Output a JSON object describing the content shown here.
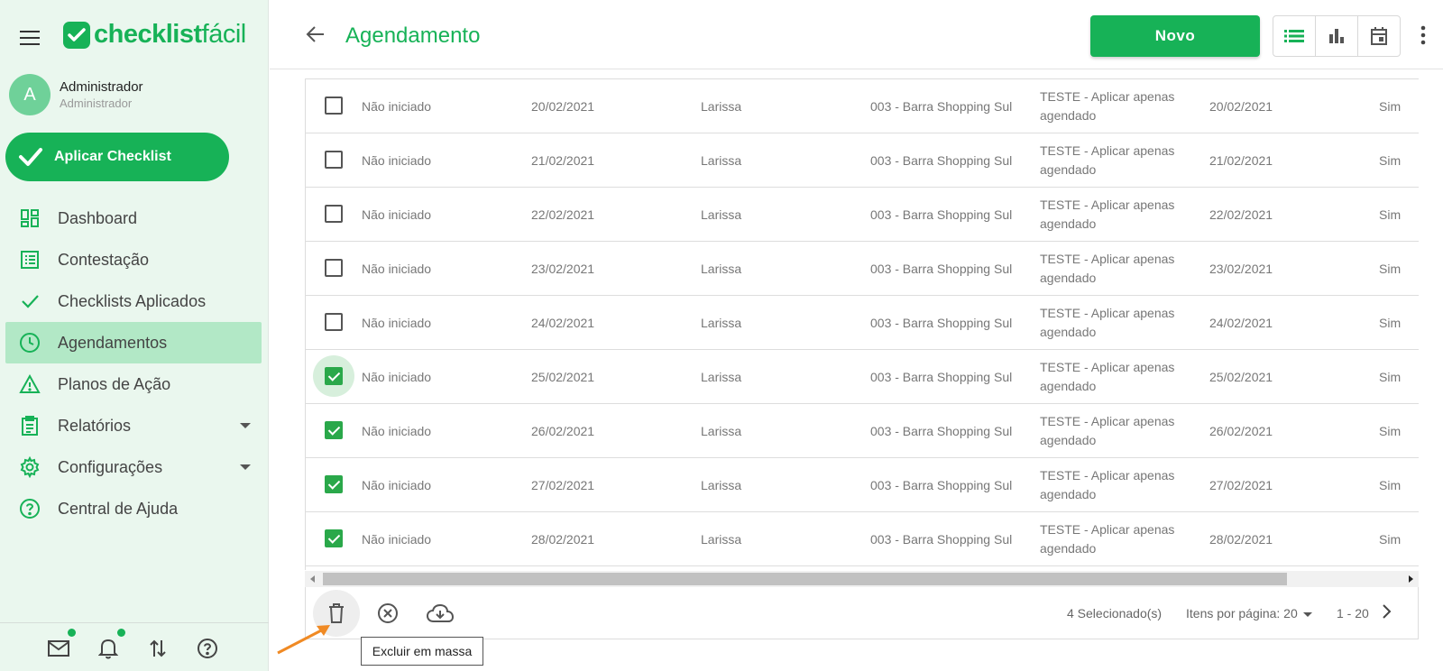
{
  "app": {
    "logo_bold": "checklist",
    "logo_light": "fácil",
    "brand_color": "#17b257"
  },
  "user": {
    "initial": "A",
    "name": "Administrador",
    "role": "Administrador"
  },
  "apply_button": "Aplicar Checklist",
  "nav": [
    {
      "label": "Dashboard",
      "icon": "dashboard-icon"
    },
    {
      "label": "Contestação",
      "icon": "list-icon"
    },
    {
      "label": "Checklists Aplicados",
      "icon": "check-icon"
    },
    {
      "label": "Agendamentos",
      "icon": "clock-icon",
      "active": true
    },
    {
      "label": "Planos de Ação",
      "icon": "warning-icon"
    },
    {
      "label": "Relatórios",
      "icon": "clipboard-icon",
      "expandable": true
    },
    {
      "label": "Configurações",
      "icon": "gear-icon",
      "expandable": true
    },
    {
      "label": "Central de Ajuda",
      "icon": "help-icon"
    }
  ],
  "header": {
    "title": "Agendamento",
    "new_button": "Novo"
  },
  "rows": [
    {
      "status": "Não iniciado",
      "date": "20/02/2021",
      "user": "Larissa",
      "unit": "003 - Barra Shopping Sul",
      "checklist_line1": "TESTE - Aplicar apenas",
      "checklist_line2": "agendado",
      "date2": "20/02/2021",
      "flag": "Sim",
      "checked": false
    },
    {
      "status": "Não iniciado",
      "date": "21/02/2021",
      "user": "Larissa",
      "unit": "003 - Barra Shopping Sul",
      "checklist_line1": "TESTE - Aplicar apenas",
      "checklist_line2": "agendado",
      "date2": "21/02/2021",
      "flag": "Sim",
      "checked": false
    },
    {
      "status": "Não iniciado",
      "date": "22/02/2021",
      "user": "Larissa",
      "unit": "003 - Barra Shopping Sul",
      "checklist_line1": "TESTE - Aplicar apenas",
      "checklist_line2": "agendado",
      "date2": "22/02/2021",
      "flag": "Sim",
      "checked": false
    },
    {
      "status": "Não iniciado",
      "date": "23/02/2021",
      "user": "Larissa",
      "unit": "003 - Barra Shopping Sul",
      "checklist_line1": "TESTE - Aplicar apenas",
      "checklist_line2": "agendado",
      "date2": "23/02/2021",
      "flag": "Sim",
      "checked": false
    },
    {
      "status": "Não iniciado",
      "date": "24/02/2021",
      "user": "Larissa",
      "unit": "003 - Barra Shopping Sul",
      "checklist_line1": "TESTE - Aplicar apenas",
      "checklist_line2": "agendado",
      "date2": "24/02/2021",
      "flag": "Sim",
      "checked": false
    },
    {
      "status": "Não iniciado",
      "date": "25/02/2021",
      "user": "Larissa",
      "unit": "003 - Barra Shopping Sul",
      "checklist_line1": "TESTE - Aplicar apenas",
      "checklist_line2": "agendado",
      "date2": "25/02/2021",
      "flag": "Sim",
      "checked": true,
      "focused": true
    },
    {
      "status": "Não iniciado",
      "date": "26/02/2021",
      "user": "Larissa",
      "unit": "003 - Barra Shopping Sul",
      "checklist_line1": "TESTE - Aplicar apenas",
      "checklist_line2": "agendado",
      "date2": "26/02/2021",
      "flag": "Sim",
      "checked": true
    },
    {
      "status": "Não iniciado",
      "date": "27/02/2021",
      "user": "Larissa",
      "unit": "003 - Barra Shopping Sul",
      "checklist_line1": "TESTE - Aplicar apenas",
      "checklist_line2": "agendado",
      "date2": "27/02/2021",
      "flag": "Sim",
      "checked": true
    },
    {
      "status": "Não iniciado",
      "date": "28/02/2021",
      "user": "Larissa",
      "unit": "003 - Barra Shopping Sul",
      "checklist_line1": "TESTE - Aplicar apenas",
      "checklist_line2": "agendado",
      "date2": "28/02/2021",
      "flag": "Sim",
      "checked": true
    }
  ],
  "footer": {
    "selected": "4 Selecionado(s)",
    "per_page": "Itens por página: 20",
    "range": "1 - 20",
    "tooltip": "Excluir em massa"
  },
  "colors": {
    "annotation_arrow": "#f08a24",
    "selected_check": "#2aa84a",
    "active_nav": "#b2e8c6"
  }
}
